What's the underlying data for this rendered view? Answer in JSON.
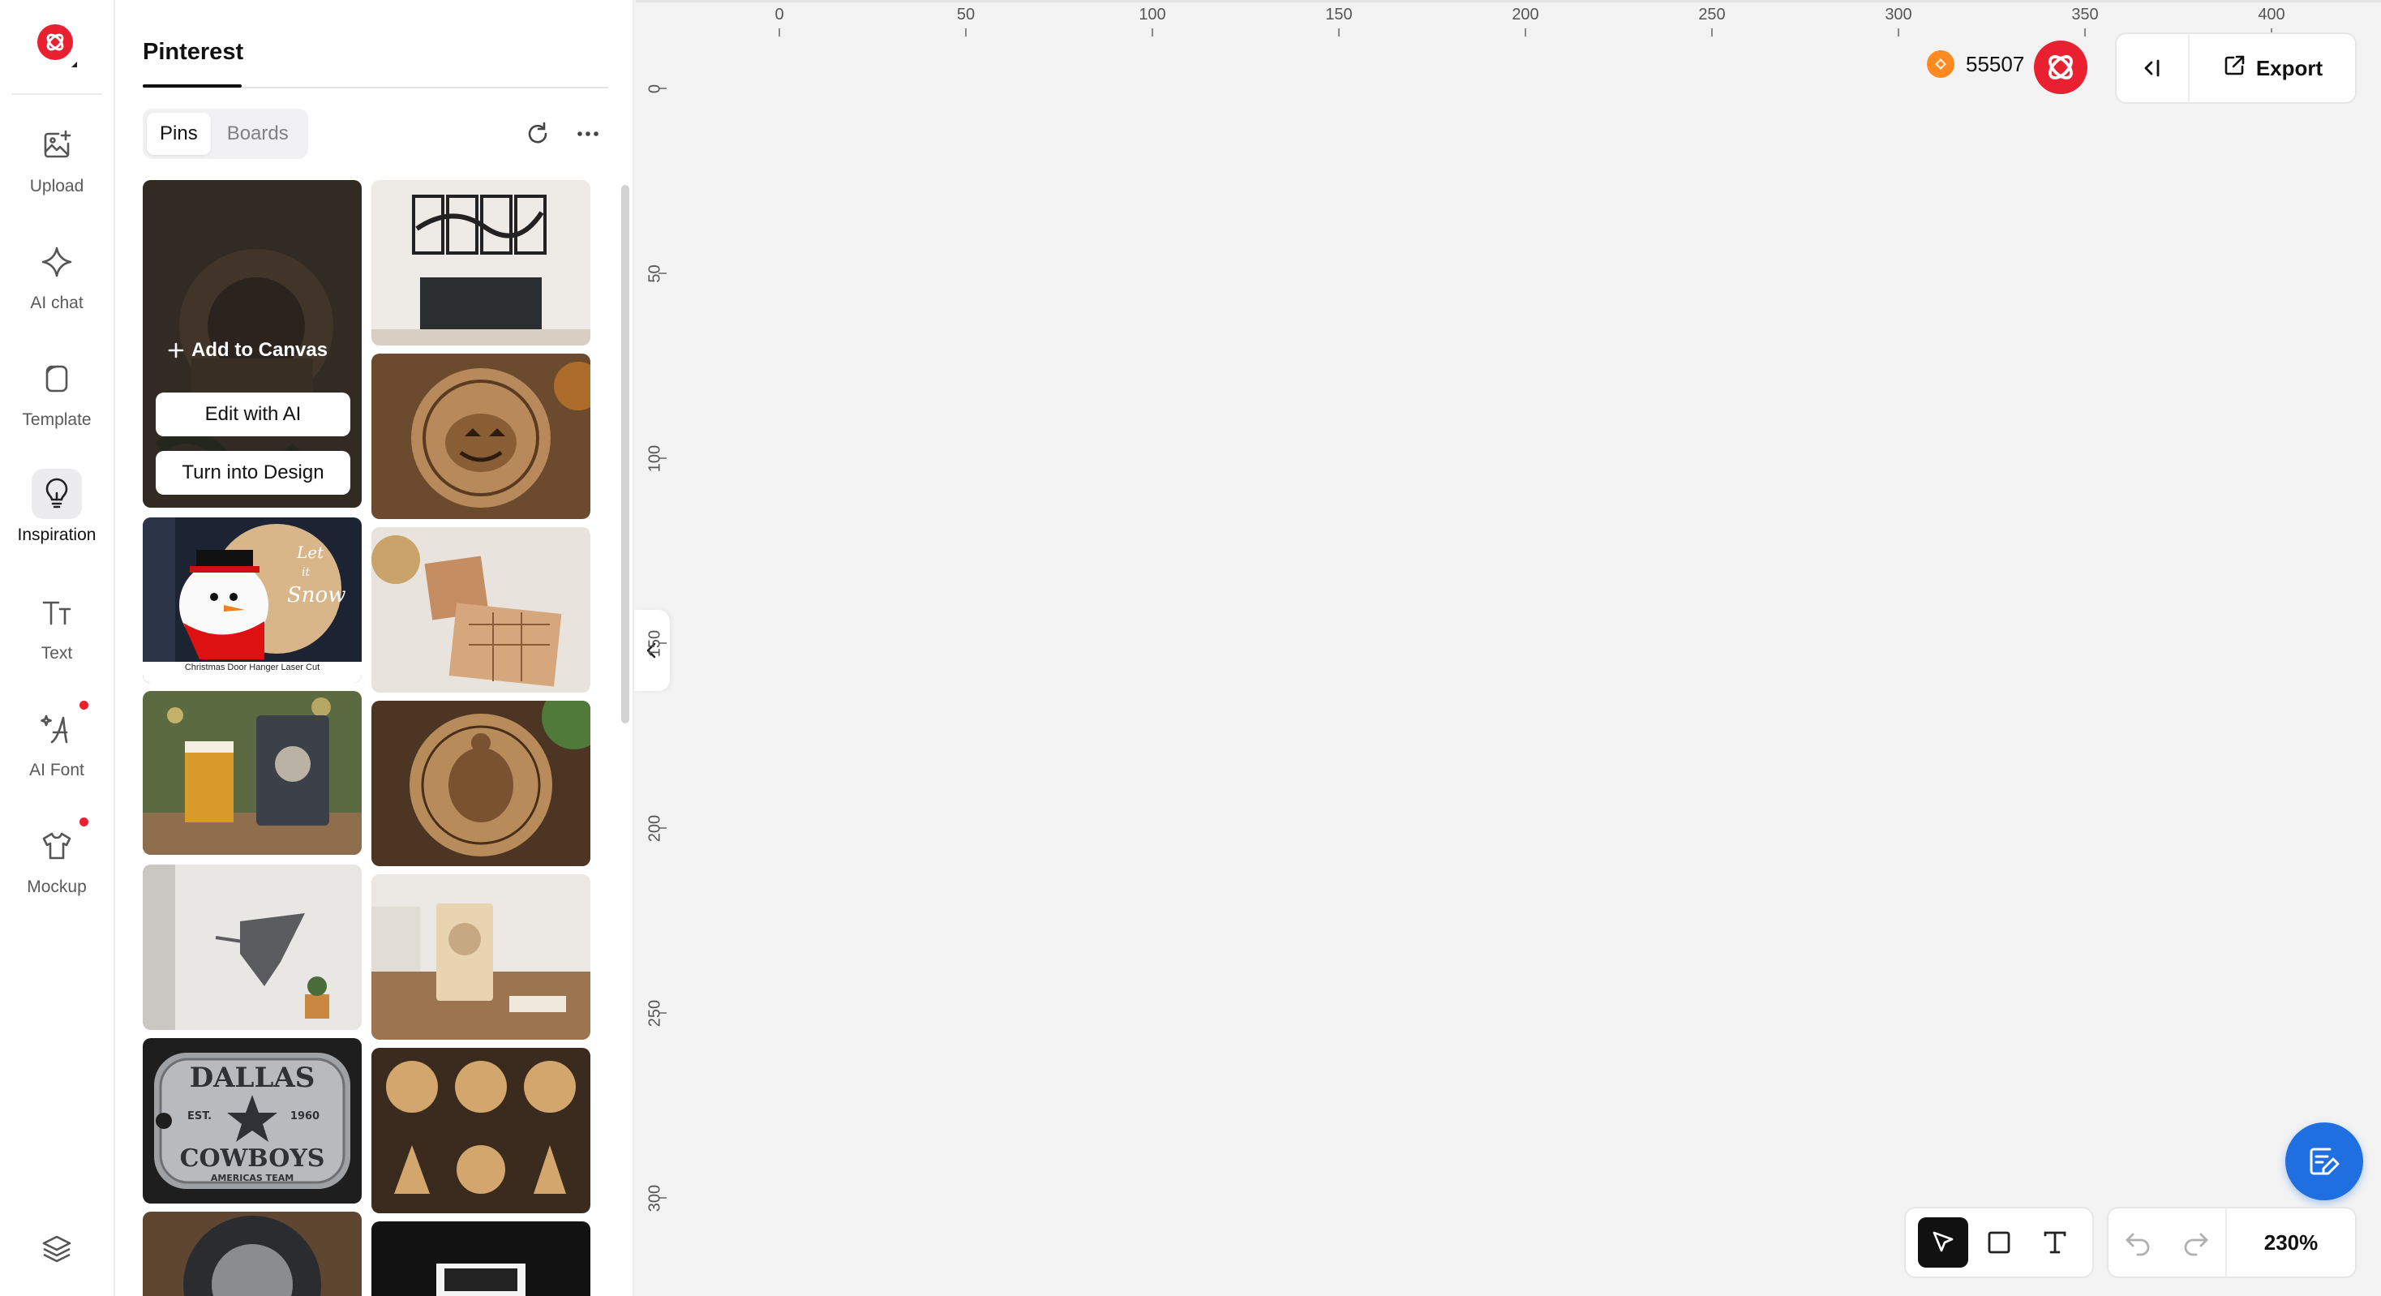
{
  "rail": {
    "items": [
      {
        "label": "Upload",
        "icon": "image-plus-icon"
      },
      {
        "label": "AI chat",
        "icon": "sparkle-icon"
      },
      {
        "label": "Template",
        "icon": "template-icon"
      },
      {
        "label": "Inspiration",
        "icon": "lightbulb-icon",
        "active": true
      },
      {
        "label": "Text",
        "icon": "text-icon"
      },
      {
        "label": "AI Font",
        "icon": "ai-font-icon",
        "badge": true
      },
      {
        "label": "Mockup",
        "icon": "tshirt-icon",
        "badge": true
      }
    ],
    "bottom_icon": "layers-icon"
  },
  "panel": {
    "title": "Pinterest",
    "tabs": [
      "Pins",
      "Boards"
    ],
    "active_tab": "Pins",
    "refresh_icon": "refresh-icon",
    "more_icon": "more-icon",
    "hover_card": {
      "add_label": "Add to Canvas",
      "edit_label": "Edit with AI",
      "design_label": "Turn into Design"
    },
    "pins": [
      {
        "name": "steampunk-gear-sign",
        "caption": ""
      },
      {
        "name": "tree-wall-art-panels",
        "caption": ""
      },
      {
        "name": "pumpkin-coaster",
        "caption": ""
      },
      {
        "name": "let-it-snow-door-hanger",
        "caption": "Christmas Door Hanger Laser Cut"
      },
      {
        "name": "wooden-puzzle-board",
        "caption": ""
      },
      {
        "name": "beer-glass-cat-frame",
        "caption": ""
      },
      {
        "name": "turtle-mandala-coaster",
        "caption": ""
      },
      {
        "name": "hummingbird-wall-art",
        "caption": ""
      },
      {
        "name": "santa-card-holder",
        "caption": ""
      },
      {
        "name": "dallas-cowboys-plaque",
        "caption": ""
      },
      {
        "name": "wooden-ornaments",
        "caption": ""
      },
      {
        "name": "buddha-slate",
        "caption": ""
      },
      {
        "name": "night-light-box",
        "caption": ""
      }
    ],
    "dallas": {
      "line1": "DALLAS",
      "est": "EST.",
      "year": "1960",
      "line2": "COWBOYS",
      "line3": "AMERICAS TEAM"
    },
    "snow": {
      "line1": "Let",
      "line2": "it",
      "line3": "Snow"
    }
  },
  "ruler": {
    "h": [
      "0",
      "50",
      "100",
      "150",
      "200",
      "250",
      "300",
      "350",
      "400"
    ],
    "v": [
      "0",
      "50",
      "100",
      "150",
      "200",
      "250",
      "300"
    ]
  },
  "topbar": {
    "credits": "55507",
    "coin_icon": "coin-icon",
    "collapse_icon": "collapse-panel-icon",
    "export_label": "Export",
    "export_icon": "export-icon"
  },
  "tools": {
    "select_icon": "cursor-icon",
    "rect_icon": "rectangle-icon",
    "text_icon": "text-tool-icon",
    "undo_icon": "undo-icon",
    "redo_icon": "redo-icon",
    "zoom": "230%"
  },
  "fab_icon": "feedback-edit-icon",
  "colors": {
    "brand": "#e8202f",
    "accent": "#1f6fe0",
    "coin": "#ff8a1f"
  }
}
